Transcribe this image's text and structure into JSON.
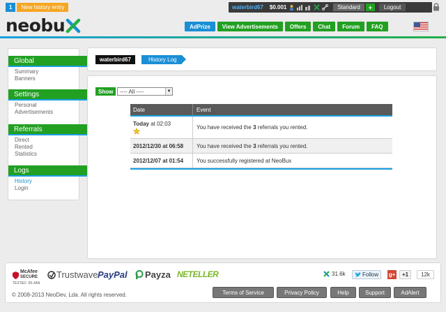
{
  "notification": {
    "count": "1",
    "text": "New history entry"
  },
  "userbar": {
    "username": "waterbird67",
    "balance": "$0.001",
    "membership": "Standard",
    "plus": "+",
    "logout": "Logout"
  },
  "logo": {
    "text": "neobu",
    "mark": "x"
  },
  "nav": {
    "items": [
      "AdPrize",
      "View Advertisements",
      "Offers",
      "Chat",
      "Forum",
      "FAQ"
    ]
  },
  "sidebar": {
    "sections": [
      {
        "title": "Global",
        "links": [
          "Summary",
          "Banners"
        ]
      },
      {
        "title": "Settings",
        "links": [
          "Personal",
          "Advertisements"
        ]
      },
      {
        "title": "Referrals",
        "links": [
          "Direct",
          "Rented",
          "Statistics"
        ]
      },
      {
        "title": "Logs",
        "links": [
          "History",
          "Login"
        ]
      }
    ],
    "active": "History"
  },
  "breadcrumb": {
    "user": "waterbird67",
    "page": "History Log"
  },
  "filter": {
    "label": "Show",
    "selected": "---- All ----"
  },
  "table": {
    "headers": [
      "Date",
      "Event"
    ],
    "rows": [
      {
        "date_prefix": "Today",
        "date_suffix": " at 02:03",
        "event_pre": "You have received the ",
        "event_num": "3",
        "event_post": " referrals you rented."
      },
      {
        "date_prefix": "2012/12/30",
        "date_suffix": " at 06:58",
        "event_pre": "You have received the ",
        "event_num": "3",
        "event_post": " referrals you rented."
      },
      {
        "date_prefix": "2012/12/07",
        "date_suffix": " at 01:54",
        "event_pre": "You successfully registered at NeoBux",
        "event_num": "",
        "event_post": ""
      }
    ]
  },
  "footer": {
    "badges": {
      "mcafee1": "McAfee",
      "mcafee2": "SECURE",
      "mcafee3": "TESTED  09-JAN",
      "trustwave": "Trustwave",
      "paypal": "PayPal",
      "payza": "Payza",
      "neteller": "NETELLER"
    },
    "social": {
      "neobux_count": "31.6k",
      "follow": "Follow",
      "gplus": "+1",
      "gplus_count": "12k"
    },
    "copyright": "© 2008-2013 NeoDev, Lda. All rights reserved.",
    "links": [
      "Terms of Service",
      "Privacy Policy",
      "Help",
      "Support",
      "AdAlert"
    ]
  },
  "colors": {
    "green": "#22a022",
    "blue": "#1a8fd6",
    "dark": "#3a3a3a"
  }
}
